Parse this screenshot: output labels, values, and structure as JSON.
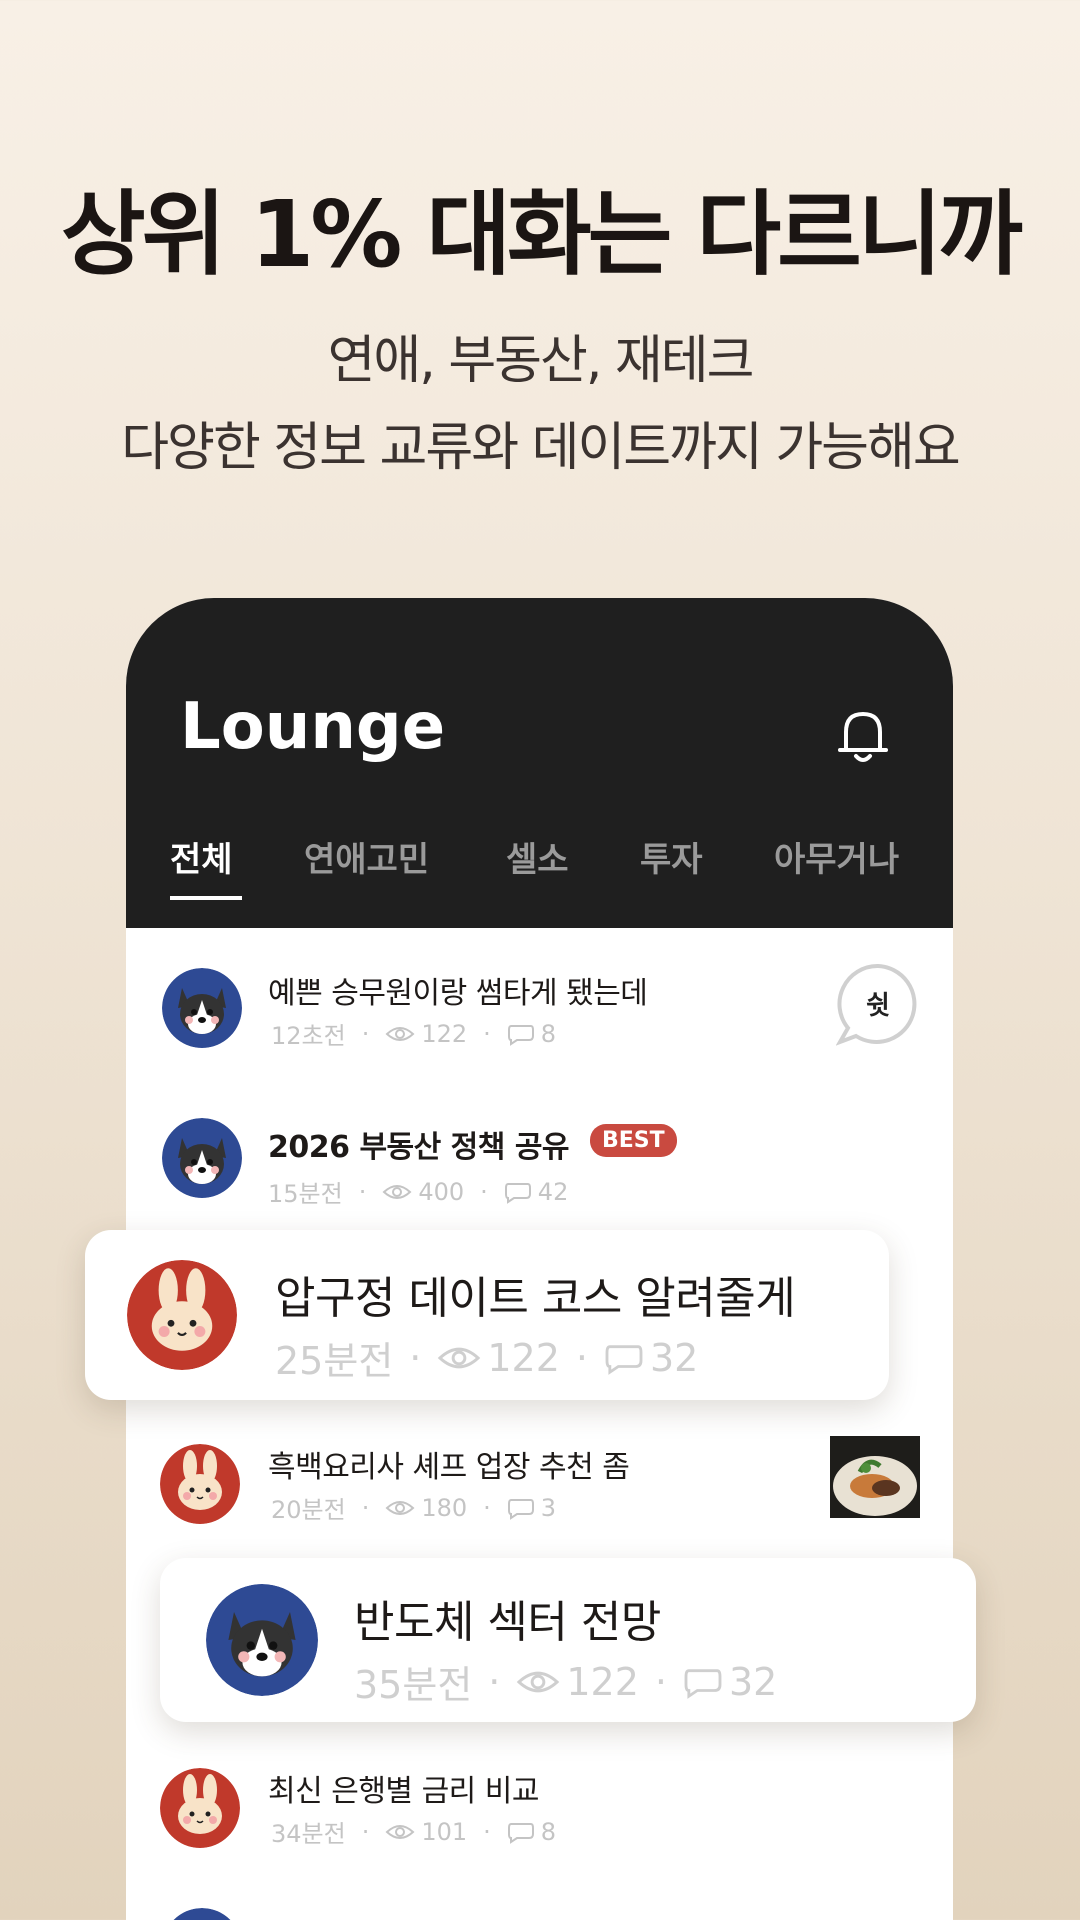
{
  "promo": {
    "headline": "상위 1% 대화는 다르니까",
    "sub1": "연애, 부동산, 재테크",
    "sub2": "다양한 정보 교류와 데이트까지 가능해요"
  },
  "app": {
    "title": "Lounge",
    "tabs": [
      "전체",
      "연애고민",
      "셀소",
      "투자",
      "아무거나"
    ],
    "active_tab": "전체"
  },
  "posts": [
    {
      "title": "예쁜 승무원이랑 썸타게 됐는데",
      "time": "12초전",
      "views": "122",
      "comments": "8",
      "avatar": "husky-avatar",
      "badge": "쉿"
    },
    {
      "title": "2026 부동산 정책 공유",
      "time": "15분전",
      "views": "400",
      "comments": "42",
      "avatar": "husky-avatar",
      "badge": "BEST"
    },
    {
      "title": "흑백요리사 셰프 업장 추천 좀",
      "time": "20분전",
      "views": "180",
      "comments": "3",
      "avatar": "bunny-avatar",
      "thumbnail": "food-thumbnail"
    },
    {
      "title": "최신 은행별 금리 비교",
      "time": "34분전",
      "views": "101",
      "comments": "8",
      "avatar": "bunny-avatar"
    }
  ],
  "cards": [
    {
      "title": "압구정 데이트 코스 알려줄게",
      "time": "25분전",
      "views": "122",
      "comments": "32",
      "avatar": "bunny-avatar"
    },
    {
      "title": "반도체 섹터 전망",
      "time": "35분전",
      "views": "122",
      "comments": "32",
      "avatar": "husky-avatar"
    }
  ],
  "colors": {
    "header_bg": "#1f1f1f",
    "best_badge": "#c94a40",
    "husky_bg": "#2e4a94",
    "bunny_bg": "#c0392b"
  }
}
